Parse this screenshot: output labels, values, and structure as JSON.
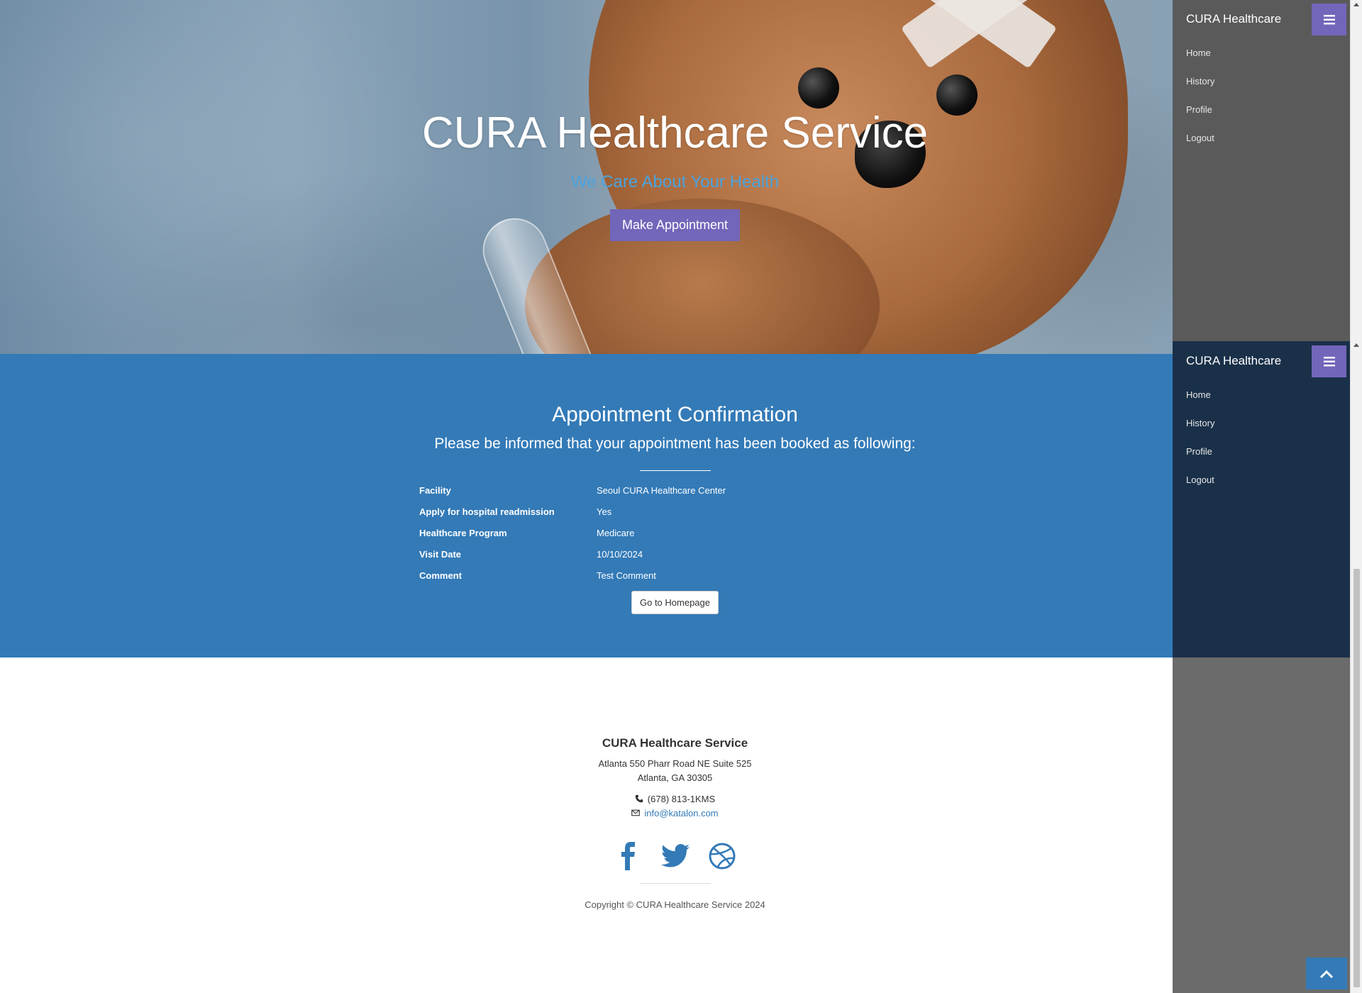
{
  "hero": {
    "title": "CURA Healthcare Service",
    "subtitle": "We Care About Your Health",
    "appointment_button": "Make Appointment"
  },
  "confirmation": {
    "title": "Appointment Confirmation",
    "subtitle": "Please be informed that your appointment has been booked as following:",
    "rows": [
      {
        "label": "Facility",
        "value": "Seoul CURA Healthcare Center"
      },
      {
        "label": "Apply for hospital readmission",
        "value": "Yes"
      },
      {
        "label": "Healthcare Program",
        "value": "Medicare"
      },
      {
        "label": "Visit Date",
        "value": "10/10/2024"
      },
      {
        "label": "Comment",
        "value": "Test Comment"
      }
    ],
    "homepage_button": "Go to Homepage"
  },
  "footer": {
    "name": "CURA Healthcare Service",
    "address_line1": "Atlanta 550 Pharr Road NE Suite 525",
    "address_line2": "Atlanta, GA 30305",
    "phone": "(678) 813-1KMS",
    "email": "info@katalon.com",
    "socials": [
      "facebook-icon",
      "twitter-icon",
      "dribbble-icon"
    ],
    "copyright": "Copyright © CURA Healthcare Service 2024"
  },
  "sidebar": {
    "brand": "CURA Healthcare",
    "items": [
      {
        "label": "Home"
      },
      {
        "label": "History"
      },
      {
        "label": "Profile"
      },
      {
        "label": "Logout"
      }
    ]
  },
  "colors": {
    "accent": "#7266ba",
    "primary": "#337ab7",
    "subtitle_blue": "#4aa3df",
    "sidebar_dark": "#1a3049"
  }
}
